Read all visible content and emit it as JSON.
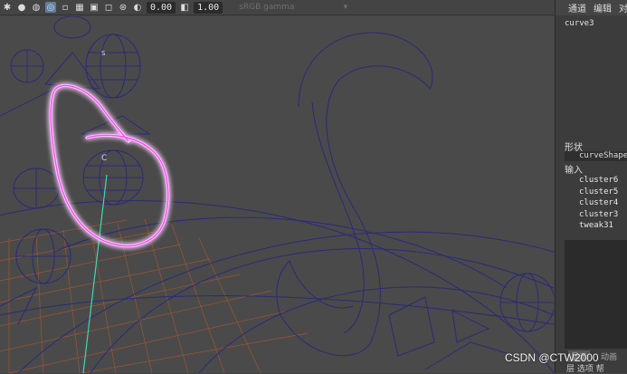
{
  "toolbar": {
    "field1_value": "0.00",
    "field2_value": "1.00",
    "colorspace_label": "sRGB gamma",
    "icons": [
      "lightbulb-icon",
      "sphere-icon",
      "textured-sphere-icon",
      "target-icon",
      "frame-icon",
      "grid-icon",
      "camera-icon",
      "square-icon",
      "aperture-icon",
      "exposure-icon",
      "gamma-icon",
      "dropdown-icon"
    ]
  },
  "viewport": {
    "labels": {
      "joint_c": "C",
      "node_s": "S"
    },
    "annotation_color": "#ff40ff"
  },
  "sidebar": {
    "tabs": [
      "通道",
      "编辑",
      "对"
    ],
    "node_name": "curve3",
    "shape_section": "形状",
    "shape_node": "curveShape",
    "inputs_section": "输入",
    "inputs": [
      "cluster6",
      "cluster5",
      "cluster4",
      "cluster3",
      "tweak31"
    ],
    "bottom_tabs": [
      "显示",
      "动画"
    ],
    "bottom_row": "层 选项 帮"
  },
  "watermark": "CSDN @CTW2000"
}
